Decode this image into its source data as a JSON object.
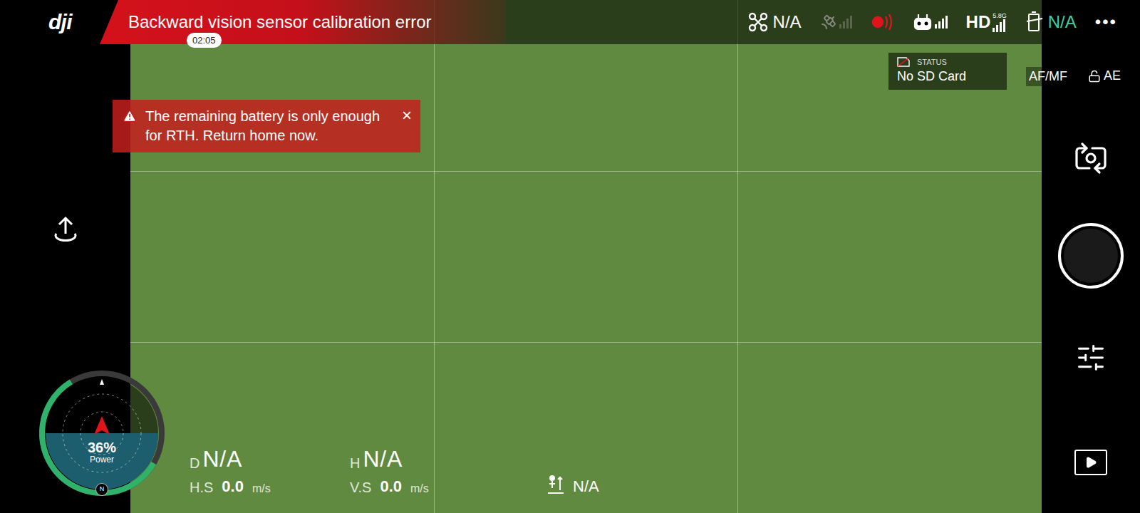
{
  "brand": "dji",
  "top_bar": {
    "alert": "Backward vision sensor calibration error",
    "flight_time": "02:05",
    "flight_mode": "N/A",
    "gps_signal": {
      "level": 0
    },
    "obstacle_warning": true,
    "remote_signal": {
      "level": 1
    },
    "video_band": "5.8G",
    "video_label": "HD",
    "video_signal": {
      "level": 1
    },
    "battery": "N/A",
    "menu": "•••"
  },
  "storage": {
    "label": "STATUS",
    "value": "No SD Card"
  },
  "focus": {
    "af_mf": "AF/MF",
    "ae": "AE",
    "ae_locked": false
  },
  "warning": {
    "text": "The remaining battery is only enough for RTH. Return home now.",
    "close": "×"
  },
  "compass": {
    "percent": "36%",
    "label": "Power",
    "north": "N",
    "level": 0.58
  },
  "telemetry": [
    {
      "label": "D",
      "value": "N/A"
    },
    {
      "label": "H",
      "value": "N/A"
    }
  ],
  "speeds": [
    {
      "label": "H.S",
      "value": "0.0",
      "unit": "m/s"
    },
    {
      "label": "V.S",
      "value": "0.0",
      "unit": "m/s"
    }
  ],
  "vps": {
    "value": "N/A"
  }
}
